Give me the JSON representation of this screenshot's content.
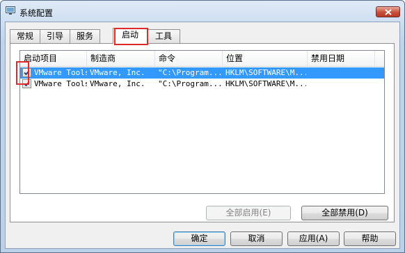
{
  "window": {
    "title": "系统配置"
  },
  "tabs": [
    {
      "label": "常规",
      "active": false
    },
    {
      "label": "引导",
      "active": false
    },
    {
      "label": "服务",
      "active": false
    },
    {
      "label": "启动",
      "active": true
    },
    {
      "label": "工具",
      "active": false
    }
  ],
  "startup_list": {
    "columns": [
      "启动项目",
      "制造商",
      "命令",
      "位置",
      "禁用日期"
    ],
    "rows": [
      {
        "checked": true,
        "selected": true,
        "item": "VMware Tools",
        "manufacturer": "VMware, Inc.",
        "command": "\"C:\\Program...",
        "location": "HKLM\\SOFTWARE\\M...",
        "disabled_date": ""
      },
      {
        "checked": true,
        "selected": false,
        "item": "VMware Tools",
        "manufacturer": "VMware, Inc.",
        "command": "\"C:\\Program...",
        "location": "HKLM\\SOFTWARE\\M...",
        "disabled_date": ""
      }
    ]
  },
  "panel_buttons": {
    "enable_all": "全部启用(E)",
    "disable_all": "全部禁用(D)"
  },
  "dialog_buttons": {
    "ok": "确定",
    "cancel": "取消",
    "apply": "应用(A)",
    "help": "帮助"
  },
  "colors": {
    "selection": "#3399ff",
    "annotation": "#e02a2a"
  }
}
